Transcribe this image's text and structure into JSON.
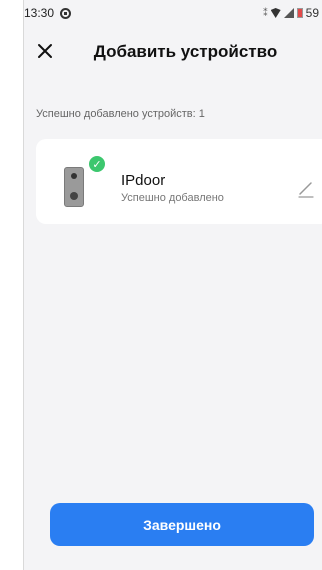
{
  "status_bar": {
    "time": "13:30",
    "battery_value": "59"
  },
  "header": {
    "title": "Добавить устройство"
  },
  "summary": {
    "text": "Успешно добавлено устройств: 1"
  },
  "device": {
    "name": "IPdoor",
    "status": "Успешно добавлено"
  },
  "footer": {
    "done_label": "Завершено"
  },
  "colors": {
    "primary": "#2a7ef2",
    "success": "#3cc76e",
    "background": "#f4f4f6"
  }
}
